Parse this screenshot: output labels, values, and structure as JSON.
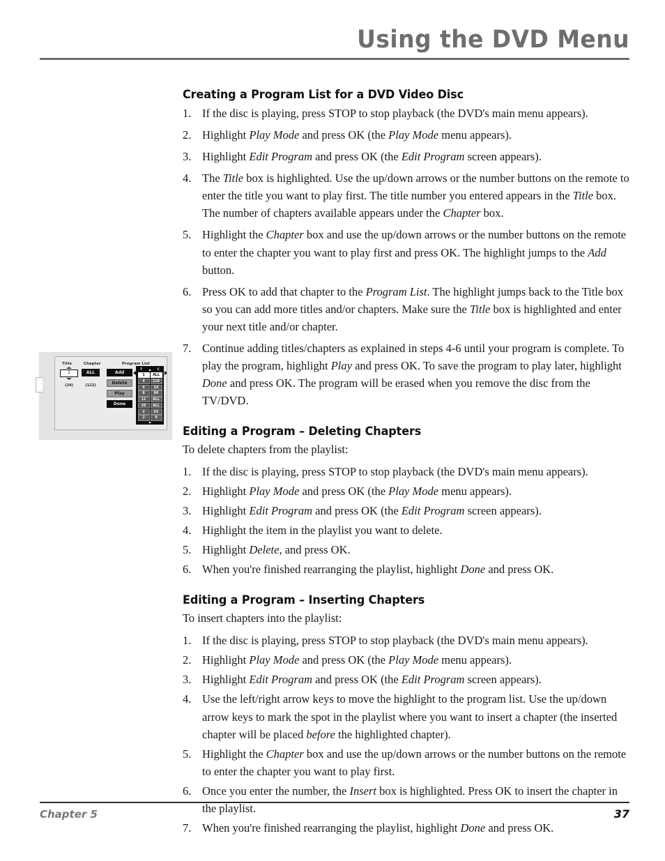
{
  "header": {
    "title": "Using the DVD Menu"
  },
  "footer": {
    "chapter": "Chapter 5",
    "page_number": "37"
  },
  "sections": [
    {
      "title": "Creating a Program List for a DVD Video Disc",
      "intro": "",
      "steps": [
        {
          "num": "1.",
          "html": "If the disc is playing, press STOP to stop playback (the DVD's main menu appears)."
        },
        {
          "num": "2.",
          "html": "Highlight <em>Play Mode</em> and press OK (the <em>Play Mode</em> menu appears)."
        },
        {
          "num": "3.",
          "html": "Highlight <em>Edit Program</em> and press OK (the <em>Edit Program</em> screen appears)."
        },
        {
          "num": "4.",
          "html": "The <em>Title</em> box is highlighted. Use the up/down arrows or the number buttons on the remote to enter the title you want to play first. The title number you entered appears in the <em>Title</em> box. The number of chapters available appears under the <em>Chapter</em> box."
        },
        {
          "num": "5.",
          "html": "Highlight the <em>Chapter</em> box and use the up/down arrows or the number buttons on the remote to enter the chapter you want to play first and press OK. The highlight jumps to the <em>Add</em> button."
        },
        {
          "num": "6.",
          "html": "Press OK to add that chapter to the <em>Program List</em>. The highlight jumps back to the Title box so you can add more titles and/or chapters. Make sure the <em>Title</em> box is highlighted and enter your next title and/or chapter."
        },
        {
          "num": "7.",
          "html": "Continue adding titles/chapters as explained in steps 4-6 until your program is complete. To play the program, highlight <em>Play</em> and press OK. To save the program to play later, highlight <em>Done</em> and press OK. The program will be erased when you remove the disc from the TV/DVD."
        }
      ]
    },
    {
      "title": "Editing a Program – Deleting Chapters",
      "intro": "To delete chapters from the playlist:",
      "steps": [
        {
          "num": "1.",
          "html": "If the disc is playing, press STOP to stop playback (the DVD's main menu appears)."
        },
        {
          "num": "2.",
          "html": "Highlight <em>Play Mode</em> and press OK (the <em>Play Mode</em> menu appears)."
        },
        {
          "num": "3.",
          "html": "Highlight <em>Edit Program</em> and press OK (the <em>Edit Program</em> screen appears)."
        },
        {
          "num": "4.",
          "html": "Highlight the item in the playlist you want to delete."
        },
        {
          "num": "5.",
          "html": "Highlight <em>Delete</em>, and press OK."
        },
        {
          "num": "6.",
          "html": "When you're finished rearranging the playlist, highlight <em>Done</em> and press OK."
        }
      ]
    },
    {
      "title": "Editing a Program – Inserting Chapters",
      "intro": "To insert chapters into the playlist:",
      "steps": [
        {
          "num": "1.",
          "html": "If the disc is playing, press STOP to stop playback (the DVD's main menu appears)."
        },
        {
          "num": "2.",
          "html": "Highlight <em>Play Mode</em> and press OK (the <em>Play Mode</em> menu appears)."
        },
        {
          "num": "3.",
          "html": "Highlight <em>Edit Program</em> and press OK (the <em>Edit Program</em> screen appears)."
        },
        {
          "num": "4.",
          "html": "Use the left/right arrow keys to move the highlight to the program list. Use the up/down arrow keys to mark the spot in the playlist where you want to insert a chapter (the inserted chapter will be placed <em>before</em> the highlighted chapter)."
        },
        {
          "num": "5.",
          "html": "Highlight the <em>Chapter</em> box and use the up/down arrows or the number buttons on the remote to enter the chapter you want to play first."
        },
        {
          "num": "6.",
          "html": "Once you enter the number, the <em>Insert</em> box is highlighted. Press OK to insert the chapter in the playlist."
        },
        {
          "num": "7.",
          "html": "When you're finished rearranging the playlist, highlight <em>Done</em> and press OK."
        }
      ]
    }
  ],
  "figure": {
    "title_label": "Title",
    "chapter_label": "Chapter",
    "program_list_label": "Program List",
    "title_value": "1",
    "title_count": "(24)",
    "chapter_value": "ALL",
    "chapter_count": "(122)",
    "buttons": [
      {
        "label": "Add",
        "style": "dark"
      },
      {
        "label": "Delete",
        "style": "light"
      },
      {
        "label": "Play",
        "style": "light"
      },
      {
        "label": "Done",
        "style": "dark"
      }
    ],
    "list_headers": {
      "t": "T",
      "c": "C"
    },
    "rows": [
      {
        "t": "1",
        "c": "ALL",
        "selected": true
      },
      {
        "t": "4",
        "c": "210",
        "selected": false
      },
      {
        "t": "6",
        "c": "24",
        "selected": false
      },
      {
        "t": "8",
        "c": "86",
        "selected": false
      },
      {
        "t": "12",
        "c": "ALL",
        "selected": false
      },
      {
        "t": "20",
        "c": "ALL",
        "selected": false
      },
      {
        "t": "2",
        "c": "62",
        "selected": false
      },
      {
        "t": "2",
        "c": "9",
        "selected": false
      }
    ]
  }
}
